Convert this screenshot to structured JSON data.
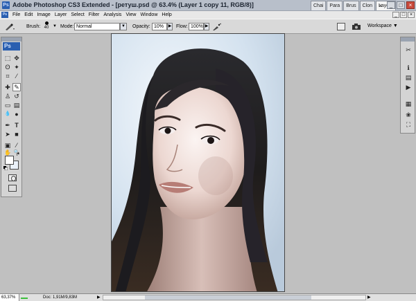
{
  "window": {
    "app_icon": "Ps",
    "title": "Adobe Photoshop CS3 Extended - [ретуш.psd @ 63.4% (Layer 1 copy 11, RGB/8)]",
    "controls": [
      "_",
      "□",
      "×"
    ]
  },
  "panel_tabs": [
    {
      "label": "Chai",
      "active": false
    },
    {
      "label": "Para",
      "active": false
    },
    {
      "label": "Brus",
      "active": false
    },
    {
      "label": "Clon",
      "active": false
    },
    {
      "label": "Layers",
      "active": true
    }
  ],
  "panel_close": "×",
  "menu": {
    "logo": "Ps",
    "items": [
      "File",
      "Edit",
      "Image",
      "Layer",
      "Select",
      "Filter",
      "Analysis",
      "View",
      "Window",
      "Help"
    ],
    "doc_controls": [
      "_",
      "□",
      "×"
    ]
  },
  "options": {
    "brush_label": "Brush:",
    "brush_size": "40",
    "mode_label": "Mode:",
    "mode_value": "Normal",
    "opacity_label": "Opacity:",
    "opacity_value": "10%",
    "flow_label": "Flow:",
    "flow_value": "100%",
    "workspace_label": "Workspace ▼",
    "icons": [
      "brush-tool-icon",
      "airbrush-icon",
      "palette-icon",
      "camera-icon"
    ]
  },
  "toolbox": {
    "logo": "Ps",
    "tools": [
      {
        "name": "marquee-tool",
        "glyph": "⬚",
        "selected": false
      },
      {
        "name": "move-tool",
        "glyph": "✥",
        "selected": false
      },
      {
        "name": "lasso-tool",
        "glyph": "ʘ",
        "selected": false
      },
      {
        "name": "magic-wand-tool",
        "glyph": "✦",
        "selected": false
      },
      {
        "name": "crop-tool",
        "glyph": "⌗",
        "selected": false
      },
      {
        "name": "slice-tool",
        "glyph": "⁄",
        "selected": false
      },
      {
        "name": "healing-brush-tool",
        "glyph": "✚",
        "selected": false
      },
      {
        "name": "brush-tool",
        "glyph": "✎",
        "selected": true
      },
      {
        "name": "clone-stamp-tool",
        "glyph": "♙",
        "selected": false
      },
      {
        "name": "history-brush-tool",
        "glyph": "↺",
        "selected": false
      },
      {
        "name": "eraser-tool",
        "glyph": "▭",
        "selected": false
      },
      {
        "name": "gradient-tool",
        "glyph": "▤",
        "selected": false
      },
      {
        "name": "blur-tool",
        "glyph": "💧",
        "selected": false
      },
      {
        "name": "dodge-tool",
        "glyph": "●",
        "selected": false
      },
      {
        "name": "pen-tool",
        "glyph": "✒",
        "selected": false
      },
      {
        "name": "type-tool",
        "glyph": "T",
        "selected": false
      },
      {
        "name": "path-selection-tool",
        "glyph": "➤",
        "selected": false
      },
      {
        "name": "shape-tool",
        "glyph": "■",
        "selected": false
      },
      {
        "name": "notes-tool",
        "glyph": "▣",
        "selected": false
      },
      {
        "name": "eyedropper-tool",
        "glyph": "⁄",
        "selected": false
      },
      {
        "name": "hand-tool",
        "glyph": "✋",
        "selected": false
      },
      {
        "name": "zoom-tool",
        "glyph": "🔍",
        "selected": false
      }
    ],
    "colors": {
      "foreground": "#ffffff",
      "background": "#eaf1f9"
    }
  },
  "right_dock": {
    "icons": [
      {
        "name": "tools-panel-icon",
        "glyph": "✂"
      },
      {
        "name": "info-panel-icon",
        "glyph": "ℹ"
      },
      {
        "name": "history-panel-icon",
        "glyph": "▤"
      },
      {
        "name": "actions-panel-icon",
        "glyph": "▶"
      },
      {
        "name": "navigator-panel-icon",
        "glyph": "▦"
      },
      {
        "name": "color-panel-icon",
        "glyph": "❀"
      },
      {
        "name": "transform-panel-icon",
        "glyph": "⛶"
      }
    ]
  },
  "status": {
    "zoom": "63,37%",
    "doc_info": "Doc: 1,91M/9,83M",
    "arrow": "▶",
    "scroll_right": "▶"
  }
}
